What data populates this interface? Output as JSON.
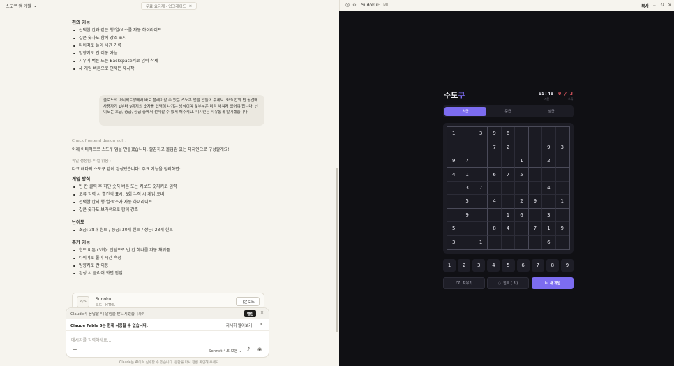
{
  "left": {
    "project_title": "스도쿠 앱 개발",
    "free_plan": "무료 요금제 · 업그레이드",
    "features_heading": "편의 기능",
    "features": [
      "선택한 칸과 같은 행/열/박스를 자동 하이라이트",
      "같은 숫자도 함께 강조 표시",
      "타이머로 풀이 시간 기록",
      "방향키로 칸 이동 가능",
      "지우기 버튼 또는 Backspace키로 입력 삭제",
      "새 게임 버튼으로 언제든 재시작"
    ],
    "user_message": "클로드의 아티팩트상에서 바로 플레이할 수 있는 스도쿠 앱을 만들어 주세요. 9*9 칸의 빈 공간에 사용자가 1부터 9까지의 숫자를 입력해 나가는 방식이며 몇부분은 미리 채워져 있어야 합니다. 난이도는 초급, 중급, 상급 중에서 선택할 수 있게 해주세요. 디자인은 자유롭게 맡기겠습니다.",
    "skill_line": "Check frontend design skill",
    "reply_intro": "이제 아티팩트로 스도쿠 앱을 만들겠습니다. 깔끔하고 몰입감 있는 디자인으로 구성할게요!",
    "files_line": "파일 생성됨, 파일 읽음",
    "summary": "다크 테마의 스도쿠 앱이 완성됐습니다! 주요 기능을 정리하면:",
    "howto_heading": "게임 방식",
    "howto": [
      "빈 칸 클릭 후 하단 숫자 버튼 또는 키보드 숫자키로 입력",
      "오류 입력 시 빨간색 표시, 3회 누적 시 게임 오버",
      "선택한 칸의 행·열·박스가 자동 하이라이트",
      "같은 숫자도 보라색으로 함께 강조"
    ],
    "difficulty_heading": "난이도",
    "difficulty": [
      "초급: 38개 힌트 / 중급: 30개 힌트 / 상급: 23개 힌트"
    ],
    "extra_heading": "추가 기능",
    "extra": [
      "힌트 버튼 (3회): 랜덤으로 빈 칸 하나를 자동 채워줌",
      "타이머로 풀이 시간 측정",
      "방향키로 칸 이동",
      "완성 시 클리어 화면 팝업"
    ],
    "artifact": {
      "title": "Sudoku",
      "subtitle": "코드 · HTML",
      "download": "다운로드",
      "icon_glyph": "</>"
    },
    "notice1": "Claude가 응답할 때 알림을 받으시겠습니까?",
    "open_label": "열림",
    "notice2": "Claude Fable 5는 현재 사용할 수 없습니다.",
    "learn_more": "자세히 알아보기",
    "input_placeholder": "메시지를 입력하세요...",
    "model": "Sonnet 4.6 보통",
    "disclaimer": "Claude는 AI이며 실수할 수 있습니다. 응답을 다시 한번 확인해 주세요."
  },
  "right": {
    "artifact_name": "Sudoku",
    "artifact_type": "HTML",
    "copy": "복사",
    "title_main": "수도",
    "title_accent": "쿠",
    "timer": "05:48",
    "timer_label": "시간",
    "errors": "0 / 3",
    "errors_label": "오류",
    "difficulties": [
      "초급",
      "중급",
      "상급"
    ],
    "active_difficulty": 0,
    "board": [
      [
        "1",
        "",
        "3",
        "9",
        "6",
        "",
        "",
        "",
        ""
      ],
      [
        "",
        "",
        "",
        "7",
        "2",
        "",
        "",
        "9",
        "3"
      ],
      [
        "9",
        "7",
        "",
        "",
        "",
        "1",
        "",
        "2",
        ""
      ],
      [
        "4",
        "1",
        "",
        "6",
        "7",
        "5",
        "",
        "",
        ""
      ],
      [
        "",
        "3",
        "7",
        "",
        "",
        "",
        "",
        "4",
        ""
      ],
      [
        "",
        "5",
        "",
        "4",
        "",
        "2",
        "9",
        "",
        "1"
      ],
      [
        "",
        "9",
        "",
        "",
        "1",
        "6",
        "",
        "3",
        ""
      ],
      [
        "5",
        "",
        "",
        "8",
        "4",
        "",
        "7",
        "1",
        "9"
      ],
      [
        "3",
        "",
        "1",
        "",
        "",
        "",
        "",
        "6",
        ""
      ]
    ],
    "numpad": [
      "1",
      "2",
      "3",
      "4",
      "5",
      "6",
      "7",
      "8",
      "9"
    ],
    "erase": "지우기",
    "hint": "힌트 ( 3 )",
    "new_game": "새 게임",
    "colors": {
      "accent": "#7c6cf0",
      "error": "#e85a63",
      "bg": "#101014"
    }
  }
}
